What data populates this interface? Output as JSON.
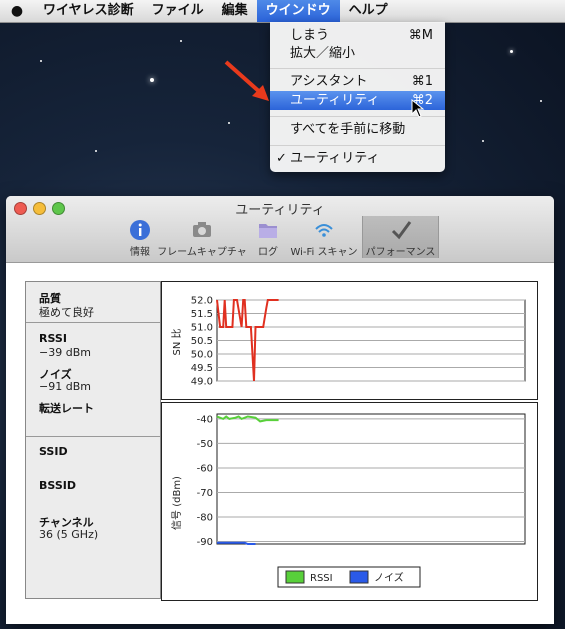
{
  "menubar": {
    "apple_glyph": "",
    "items": [
      "ワイヤレス診断",
      "ファイル",
      "編集",
      "ウインドウ",
      "ヘルプ"
    ],
    "active_index": 3
  },
  "dropdown": {
    "groups": [
      [
        {
          "label": "しまう",
          "shortcut": "⌘M"
        },
        {
          "label": "拡大／縮小",
          "shortcut": ""
        }
      ],
      [
        {
          "label": "アシスタント",
          "shortcut": "⌘1"
        },
        {
          "label": "ユーティリティ",
          "shortcut": "⌘2",
          "highlighted": true
        }
      ],
      [
        {
          "label": "すべてを手前に移動",
          "shortcut": ""
        }
      ],
      [
        {
          "label": "ユーティリティ",
          "shortcut": "",
          "checked": true
        }
      ]
    ],
    "check_glyph": "✓"
  },
  "window": {
    "title": "ユーティリティ",
    "toolbar": [
      {
        "label": "情報",
        "icon": "info-icon"
      },
      {
        "label": "フレームキャプチャ",
        "icon": "camera-icon"
      },
      {
        "label": "ログ",
        "icon": "folder-icon"
      },
      {
        "label": "Wi-Fi スキャン",
        "icon": "wifi-icon"
      },
      {
        "label": "パフォーマンス",
        "icon": "checkmark-icon",
        "selected": true
      }
    ]
  },
  "info": {
    "quality_label": "品質",
    "quality_value": "極めて良好",
    "rssi_label": "RSSI",
    "rssi_value": "−39 dBm",
    "noise_label": "ノイズ",
    "noise_value": "−91 dBm",
    "rate_label": "転送レート",
    "ssid_label": "SSID",
    "bssid_label": "BSSID",
    "channel_label": "チャンネル",
    "channel_value": "36 (5 GHz)"
  },
  "chart_data": [
    {
      "type": "line",
      "ylabel": "SN 比",
      "ylim": [
        49.0,
        52.0
      ],
      "yticks": [
        "52.0",
        "51.5",
        "51.0",
        "50.5",
        "50.0",
        "49.5",
        "49.0"
      ],
      "grid": true,
      "series": [
        {
          "color": "#e03020",
          "x": [
            0,
            2,
            4,
            5,
            6,
            8,
            10,
            11,
            13,
            16,
            17,
            18,
            19,
            22,
            24,
            25,
            28,
            30,
            32,
            33,
            38,
            40
          ],
          "y": [
            52.0,
            51.0,
            51.0,
            52.0,
            51.0,
            51.0,
            51.0,
            52.0,
            52.0,
            51.0,
            52.0,
            52.0,
            51.0,
            51.0,
            49.0,
            51.0,
            51.0,
            51.0,
            51.7,
            52.0,
            52.0,
            52.0
          ]
        }
      ]
    },
    {
      "type": "line",
      "ylabel": "信号 (dBm)",
      "ylim": [
        -91,
        -38
      ],
      "yticks": [
        "-40",
        "-50",
        "-60",
        "-70",
        "-80",
        "-90"
      ],
      "grid": true,
      "legend": "bottom-center",
      "series": [
        {
          "name": "RSSI",
          "color": "#58d03a",
          "x": [
            0,
            4,
            6,
            8,
            12,
            14,
            16,
            20,
            25,
            28,
            32,
            40
          ],
          "y": [
            -39,
            -40,
            -39,
            -40,
            -39.5,
            -39,
            -40,
            -39,
            -39.5,
            -41,
            -40.5,
            -40.5
          ]
        },
        {
          "name": "ノイズ",
          "color": "#2a5ae8",
          "x": [
            0,
            10,
            18,
            20,
            25
          ],
          "y": [
            -90.5,
            -90.5,
            -90.5,
            -91,
            -91
          ]
        }
      ]
    }
  ]
}
